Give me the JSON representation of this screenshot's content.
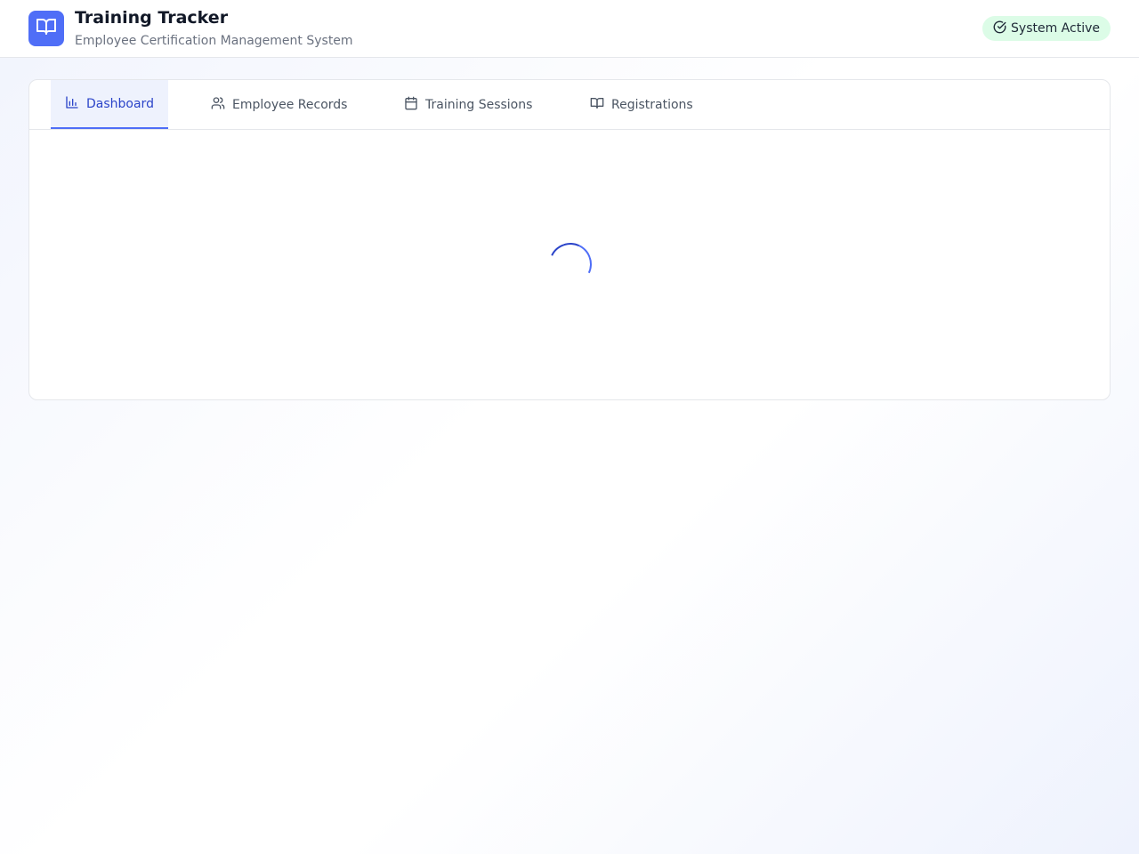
{
  "header": {
    "title": "Training Tracker",
    "subtitle": "Employee Certification Management System",
    "logo_icon": "book-open-icon",
    "status": {
      "label": "System Active",
      "icon": "check-circle-icon",
      "color": "#dcfce7"
    }
  },
  "tabs": [
    {
      "label": "Dashboard",
      "icon": "bar-chart-icon",
      "active": true
    },
    {
      "label": "Employee Records",
      "icon": "users-icon",
      "active": false
    },
    {
      "label": "Training Sessions",
      "icon": "calendar-icon",
      "active": false
    },
    {
      "label": "Registrations",
      "icon": "book-open-icon",
      "active": false
    }
  ],
  "content": {
    "state": "loading",
    "spinner_icon": "loading-spinner-icon"
  },
  "colors": {
    "accent": "#4f6ef7",
    "accent_dark": "#2b44c9",
    "success_bg": "#dcfce7"
  }
}
